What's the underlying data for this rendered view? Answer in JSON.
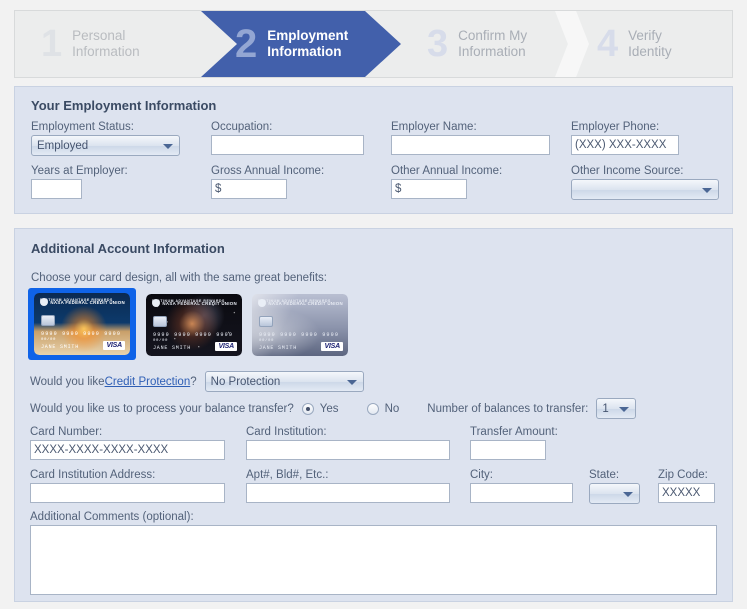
{
  "wizard": {
    "steps": [
      {
        "num": "1",
        "line1": "Personal",
        "line2": "Information",
        "state": "inactive"
      },
      {
        "num": "2",
        "line1": "Employment",
        "line2": "Information",
        "state": "active"
      },
      {
        "num": "3",
        "line1": "Confirm My",
        "line2": "Information",
        "state": "inactive"
      },
      {
        "num": "4",
        "line1": "Verify",
        "line2": "Identity",
        "state": "inactive"
      }
    ]
  },
  "employment": {
    "title": "Your Employment Information",
    "status_label": "Employment Status:",
    "status_value": "Employed",
    "occupation_label": "Occupation:",
    "occupation_value": "",
    "employer_name_label": "Employer Name:",
    "employer_name_value": "",
    "employer_phone_label": "Employer Phone:",
    "employer_phone_value": "(XXX) XXX-XXXX",
    "years_label": "Years at Employer:",
    "years_value": "",
    "gross_income_label": "Gross Annual Income:",
    "gross_income_value": "$",
    "other_income_label": "Other Annual Income:",
    "other_income_value": "$",
    "other_source_label": "Other Income Source:",
    "other_source_value": ""
  },
  "additional": {
    "title": "Additional Account Information",
    "card_prompt": "Choose your card design, all with the same great benefits:",
    "cards": [
      {
        "name": "shuttle-launch-card",
        "selected": true,
        "brand": "PLATINUM ADVANTAGE REWARDS",
        "issuer": "NASA FEDERAL CREDIT UNION",
        "number": "9999 9999 9999 9999",
        "expiry": "00/00",
        "holder": "JANE SMITH",
        "network": "VISA"
      },
      {
        "name": "nebula-card",
        "selected": false,
        "brand": "PLATINUM ADVANTAGE REWARDS",
        "issuer": "NASA FEDERAL CREDIT UNION",
        "number": "9999 9999 9999 9999",
        "expiry": "00/00",
        "holder": "JANE SMITH",
        "network": "VISA"
      },
      {
        "name": "silver-orbit-card",
        "selected": false,
        "brand": "PLATINUM ADVANTAGE REWARDS",
        "issuer": "NASA FEDERAL CREDIT UNION",
        "number": "9999 9999 9999 9999",
        "expiry": "00/00",
        "holder": "JANE SMITH",
        "network": "VISA"
      }
    ],
    "protection_pre": "Would you like ",
    "protection_link": "Credit Protection",
    "protection_post": "?",
    "protection_value": "No Protection",
    "balance_question": "Would you like us to process your balance transfer?",
    "yes_label": "Yes",
    "no_label": "No",
    "balance_selected": "Yes",
    "num_balances_label": "Number of balances to transfer:",
    "num_balances_value": "1",
    "card_number_label": "Card Number:",
    "card_number_value": "XXXX-XXXX-XXXX-XXXX",
    "card_institution_label": "Card Institution:",
    "card_institution_value": "",
    "transfer_amount_label": "Transfer Amount:",
    "transfer_amount_value": "",
    "institution_address_label": "Card Institution Address:",
    "institution_address_value": "",
    "apt_label": "Apt#, Bld#, Etc.:",
    "apt_value": "",
    "city_label": "City:",
    "city_value": "",
    "state_label": "State:",
    "state_value": "",
    "zip_label": "Zip Code:",
    "zip_value": "XXXXX",
    "comments_label": "Additional Comments (optional):",
    "comments_value": ""
  },
  "colors": {
    "active_step": "#4260ab",
    "panel_bg": "#dde3ef",
    "page_bg": "#f2f2f2",
    "link": "#2f5fb5",
    "card_selection": "#0f63e8"
  }
}
